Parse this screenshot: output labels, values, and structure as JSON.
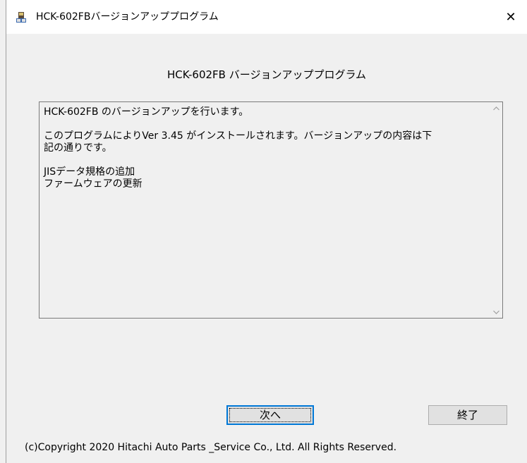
{
  "window": {
    "title": "HCK-602FBバージョンアッププログラム",
    "app_icon": "installer-icon",
    "close_glyph": "✕"
  },
  "heading": "HCK-602FB バージョンアッププログラム",
  "message": {
    "paragraph1": "HCK-602FB のバージョンアップを行います。",
    "paragraph2_line1": "このプログラムによりVer 3.45 がインストールされます。バージョンアップの内容は下",
    "paragraph2_line2": "記の通りです。",
    "item1": "JISデータ規格の追加",
    "item2": "ファームウェアの更新"
  },
  "buttons": {
    "next_label": "次へ",
    "exit_label": "終了"
  },
  "copyright": "(c)Copyright 2020  Hitachi Auto Parts _Service Co., Ltd. All Rights Reserved.",
  "colors": {
    "focus_accent": "#0078d7"
  }
}
